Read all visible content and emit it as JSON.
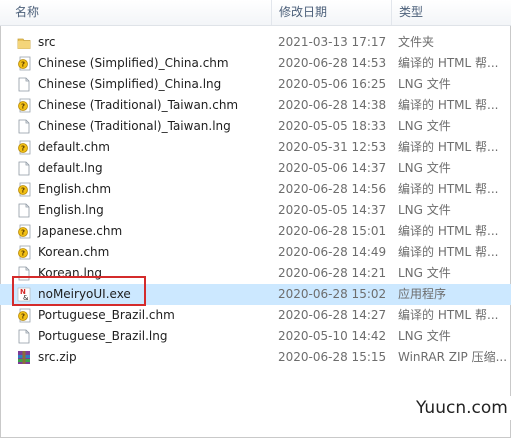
{
  "columns": {
    "name": "名称",
    "date": "修改日期",
    "type": "类型"
  },
  "files": [
    {
      "name": "src",
      "date": "2021-03-13 17:17",
      "type": "文件夹",
      "icon": "folder-icon"
    },
    {
      "name": "Chinese (Simplified)_China.chm",
      "date": "2020-06-28 14:53",
      "type": "编译的 HTML 帮...",
      "icon": "chm-icon"
    },
    {
      "name": "Chinese (Simplified)_China.lng",
      "date": "2020-05-06 16:25",
      "type": "LNG 文件",
      "icon": "document-icon"
    },
    {
      "name": "Chinese (Traditional)_Taiwan.chm",
      "date": "2020-06-28 14:38",
      "type": "编译的 HTML 帮...",
      "icon": "chm-icon"
    },
    {
      "name": "Chinese (Traditional)_Taiwan.lng",
      "date": "2020-05-05 18:33",
      "type": "LNG 文件",
      "icon": "document-icon"
    },
    {
      "name": "default.chm",
      "date": "2020-05-31 12:53",
      "type": "编译的 HTML 帮...",
      "icon": "chm-icon"
    },
    {
      "name": "default.lng",
      "date": "2020-05-06 14:37",
      "type": "LNG 文件",
      "icon": "document-icon"
    },
    {
      "name": "English.chm",
      "date": "2020-06-28 14:56",
      "type": "编译的 HTML 帮...",
      "icon": "chm-icon"
    },
    {
      "name": "English.lng",
      "date": "2020-05-05 14:37",
      "type": "LNG 文件",
      "icon": "document-icon"
    },
    {
      "name": "Japanese.chm",
      "date": "2020-06-28 15:01",
      "type": "编译的 HTML 帮...",
      "icon": "chm-icon"
    },
    {
      "name": "Korean.chm",
      "date": "2020-06-28 14:49",
      "type": "编译的 HTML 帮...",
      "icon": "chm-icon"
    },
    {
      "name": "Korean.lng",
      "date": "2020-06-28 14:21",
      "type": "LNG 文件",
      "icon": "document-icon"
    },
    {
      "name": "noMeiryoUI.exe",
      "date": "2020-06-28 15:02",
      "type": "应用程序",
      "icon": "exe-icon",
      "selected": true
    },
    {
      "name": "Portuguese_Brazil.chm",
      "date": "2020-06-28 14:27",
      "type": "编译的 HTML 帮...",
      "icon": "chm-icon"
    },
    {
      "name": "Portuguese_Brazil.lng",
      "date": "2020-05-10 14:42",
      "type": "LNG 文件",
      "icon": "document-icon"
    },
    {
      "name": "src.zip",
      "date": "2020-06-28 15:15",
      "type": "WinRAR ZIP 压缩...",
      "icon": "winrar-icon"
    }
  ],
  "watermark": "Yuucn.com",
  "colors": {
    "selection": "#cce8ff",
    "highlight_box": "#d42b2b",
    "header_text": "#4c607a"
  }
}
